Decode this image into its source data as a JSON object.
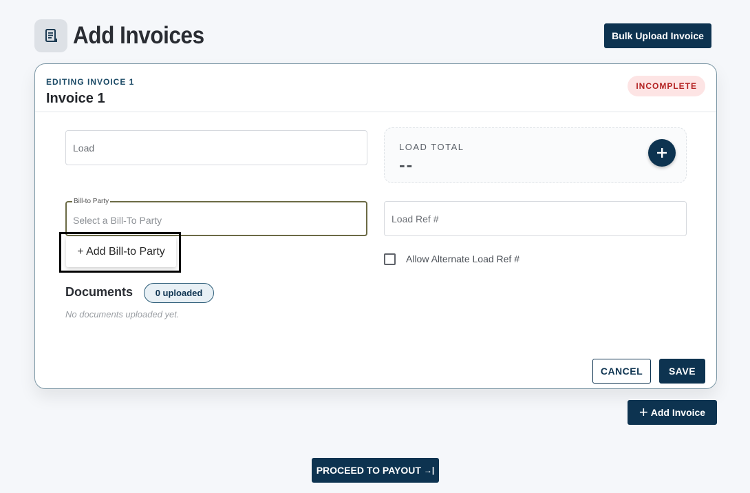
{
  "header": {
    "title": "Add Invoices",
    "bulk_upload_label": "Bulk Upload Invoice"
  },
  "invoice": {
    "editing_label": "EDITING INVOICE 1",
    "title": "Invoice 1",
    "status": "INCOMPLETE",
    "load_placeholder": "Load",
    "load_total_label": "LOAD TOTAL",
    "load_total_value": "--",
    "bill_to_label": "Bill-to Party",
    "bill_to_placeholder": "Select a Bill-To Party",
    "add_bill_to_option": "+ Add Bill-to Party",
    "load_ref_placeholder": "Load Ref #",
    "allow_alt_ref_label": "Allow Alternate Load Ref #",
    "allow_alt_ref_checked": false,
    "documents_title": "Documents",
    "documents_badge": "0 uploaded",
    "documents_empty": "No documents uploaded yet.",
    "cancel_label": "CANCEL",
    "save_label": "SAVE"
  },
  "footer": {
    "add_invoice_label": "Add Invoice",
    "proceed_label": "PROCEED TO PAYOUT"
  },
  "icons": {
    "page": "invoice-document-icon",
    "add_load_total": "plus-icon",
    "add_invoice": "plus-icon",
    "proceed": "arrow-right-to-bar-icon"
  },
  "colors": {
    "primary": "#0d3350",
    "status_bg": "#fde4e4",
    "status_text": "#b42323",
    "card_border": "#7d98a6"
  }
}
